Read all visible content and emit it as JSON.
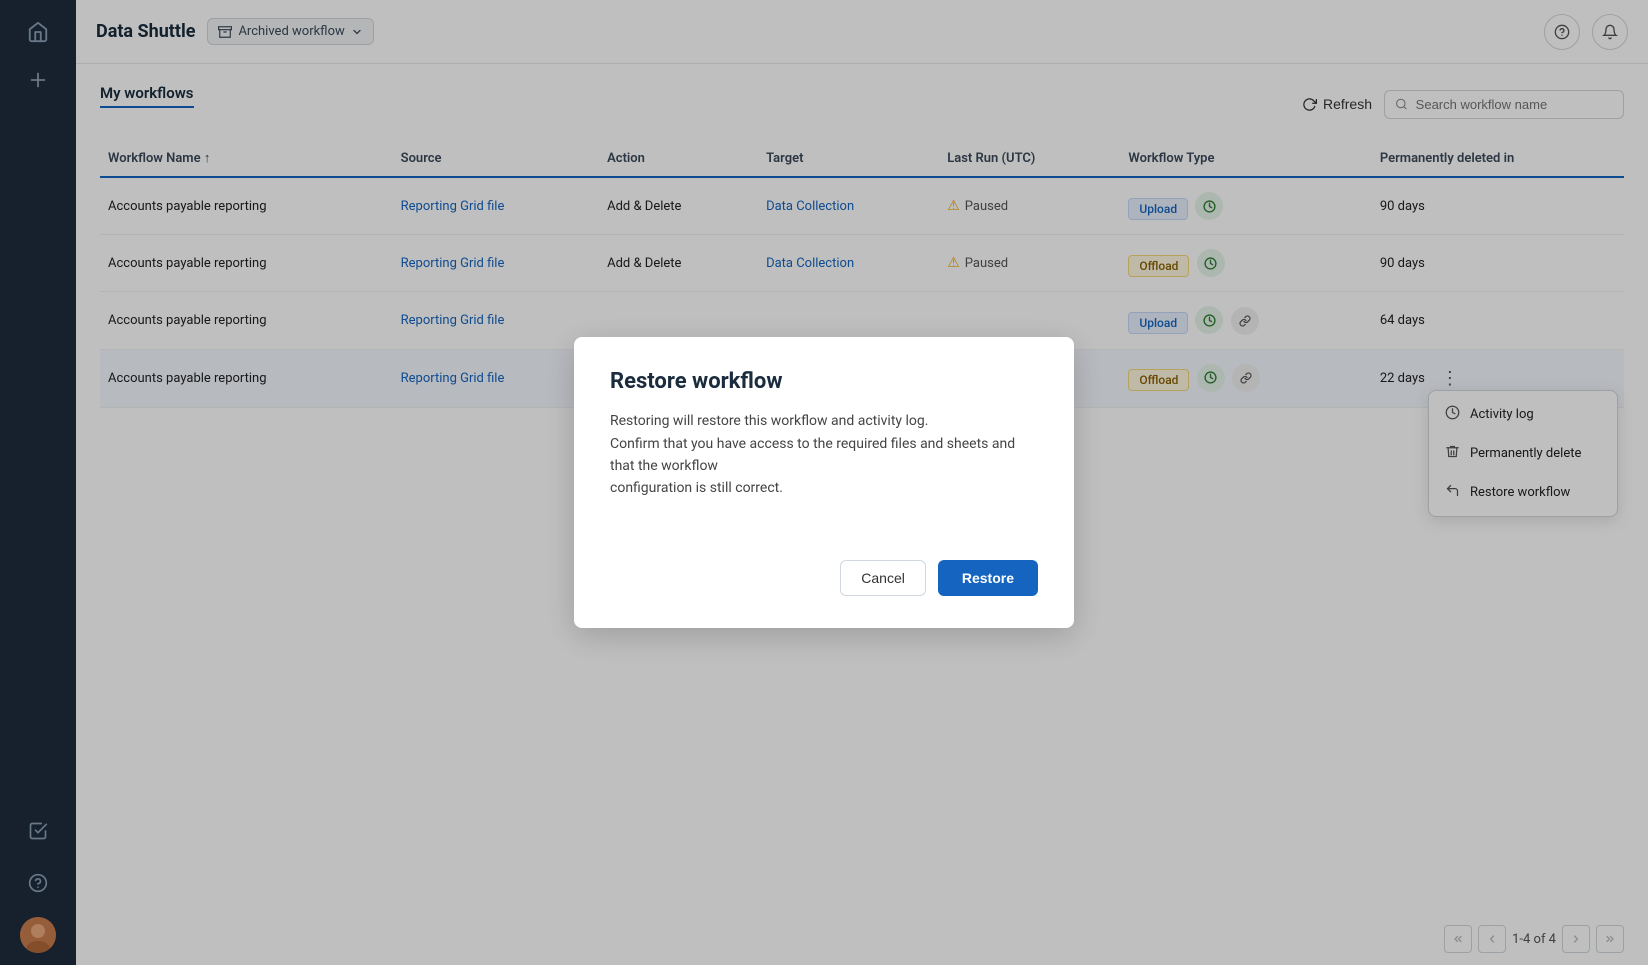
{
  "sidebar": {
    "home_label": "Home",
    "add_label": "Add",
    "checklist_label": "Checklist",
    "help_label": "Help",
    "avatar_label": "User avatar"
  },
  "topbar": {
    "app_title": "Data Shuttle",
    "archived_badge_label": "Archived workflow",
    "help_icon": "?",
    "bell_icon": "🔔"
  },
  "toolbar": {
    "section_title": "My workflows",
    "refresh_label": "Refresh",
    "search_placeholder": "Search workflow name"
  },
  "table": {
    "columns": [
      {
        "key": "name",
        "label": "Workflow Name ↑"
      },
      {
        "key": "source",
        "label": "Source"
      },
      {
        "key": "action",
        "label": "Action"
      },
      {
        "key": "target",
        "label": "Target"
      },
      {
        "key": "last_run",
        "label": "Last Run (UTC)"
      },
      {
        "key": "type",
        "label": "Workflow Type"
      },
      {
        "key": "perm_delete",
        "label": "Permanently deleted in"
      }
    ],
    "rows": [
      {
        "name": "Accounts payable reporting",
        "source": "Reporting Grid file",
        "action": "Add & Delete",
        "target": "Data Collection",
        "last_run_icon": "⚠",
        "last_run_status": "Paused",
        "type": "Upload",
        "perm_delete": "90 days",
        "has_clock": true,
        "has_more": false,
        "highlighted": false
      },
      {
        "name": "Accounts payable reporting",
        "source": "Reporting Grid file",
        "action": "Add & Delete",
        "target": "Data Collection",
        "last_run_icon": "⚠",
        "last_run_status": "Paused",
        "type": "Offload",
        "perm_delete": "90 days",
        "has_clock": true,
        "has_more": false,
        "highlighted": false
      },
      {
        "name": "Accounts payable reporting",
        "source": "Reporting Grid file",
        "action": "",
        "target": "",
        "last_run_icon": "",
        "last_run_status": "",
        "type": "Upload",
        "perm_delete": "64 days",
        "has_clock": true,
        "has_link": true,
        "has_more": false,
        "highlighted": false
      },
      {
        "name": "Accounts payable reporting",
        "source": "Reporting Grid file",
        "action": "",
        "target": "",
        "last_run_icon": "",
        "last_run_status": "",
        "type": "Offload",
        "perm_delete": "22 days",
        "has_clock": true,
        "has_link": true,
        "has_more": true,
        "highlighted": true
      }
    ]
  },
  "context_menu": {
    "items": [
      {
        "label": "Activity log",
        "icon": "activity"
      },
      {
        "label": "Permanently delete",
        "icon": "trash"
      },
      {
        "label": "Restore workflow",
        "icon": "restore"
      }
    ]
  },
  "modal": {
    "title": "Restore workflow",
    "body_line1": "Restoring will restore this workflow and activity log.",
    "body_line2": "Confirm that you have access to the required files and sheets and that the workflow",
    "body_line3": "configuration is still correct.",
    "cancel_label": "Cancel",
    "restore_label": "Restore"
  },
  "pagination": {
    "info": "1-4 of 4"
  }
}
